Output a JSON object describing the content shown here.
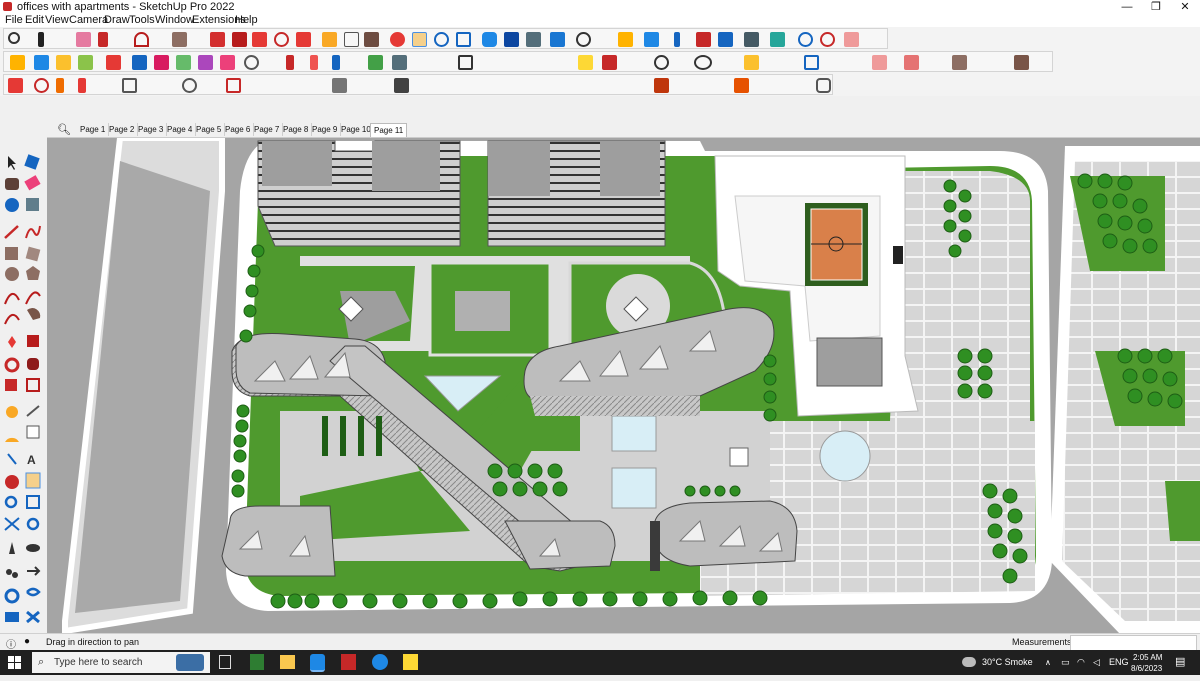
{
  "window": {
    "title": "offices with apartments - SketchUp Pro 2022",
    "minimize": "—",
    "maximize": "❐",
    "close": "✕"
  },
  "menu": [
    "File",
    "Edit",
    "View",
    "Camera",
    "Draw",
    "Tools",
    "Window",
    "Extensions",
    "Help"
  ],
  "scene_tabs": [
    "Page 1",
    "Page 2",
    "Page 3",
    "Page 4",
    "Page 5",
    "Page 6",
    "Page 7",
    "Page 8",
    "Page 9",
    "Page 10",
    "Page 11"
  ],
  "selected_tab": "Page 11",
  "status": {
    "hint": "Drag in direction to pan",
    "measurements_label": "Measurements",
    "measurements_value": ""
  },
  "taskbar": {
    "search_placeholder": "Type here to search",
    "weather": "30°C  Smoke",
    "language": "ENG",
    "time": "2:05 AM",
    "date": "8/6/2023"
  },
  "colors": {
    "grass": "#4f9a2e",
    "tree": "#2f8f22",
    "building": "#bdbdbd",
    "paving": "#d4d4d4",
    "road": "#a9a9a9",
    "water": "#d8eef6",
    "court": "#d9804a"
  },
  "icons": {
    "zoom": "magnifier-icon",
    "select": "select-arrow-icon",
    "eraser": "eraser-icon",
    "pencil": "pencil-icon",
    "orbit": "orbit-icon",
    "pan": "pan-hand-icon",
    "measure": "tape-measure-icon",
    "paint": "paint-bucket-icon"
  }
}
